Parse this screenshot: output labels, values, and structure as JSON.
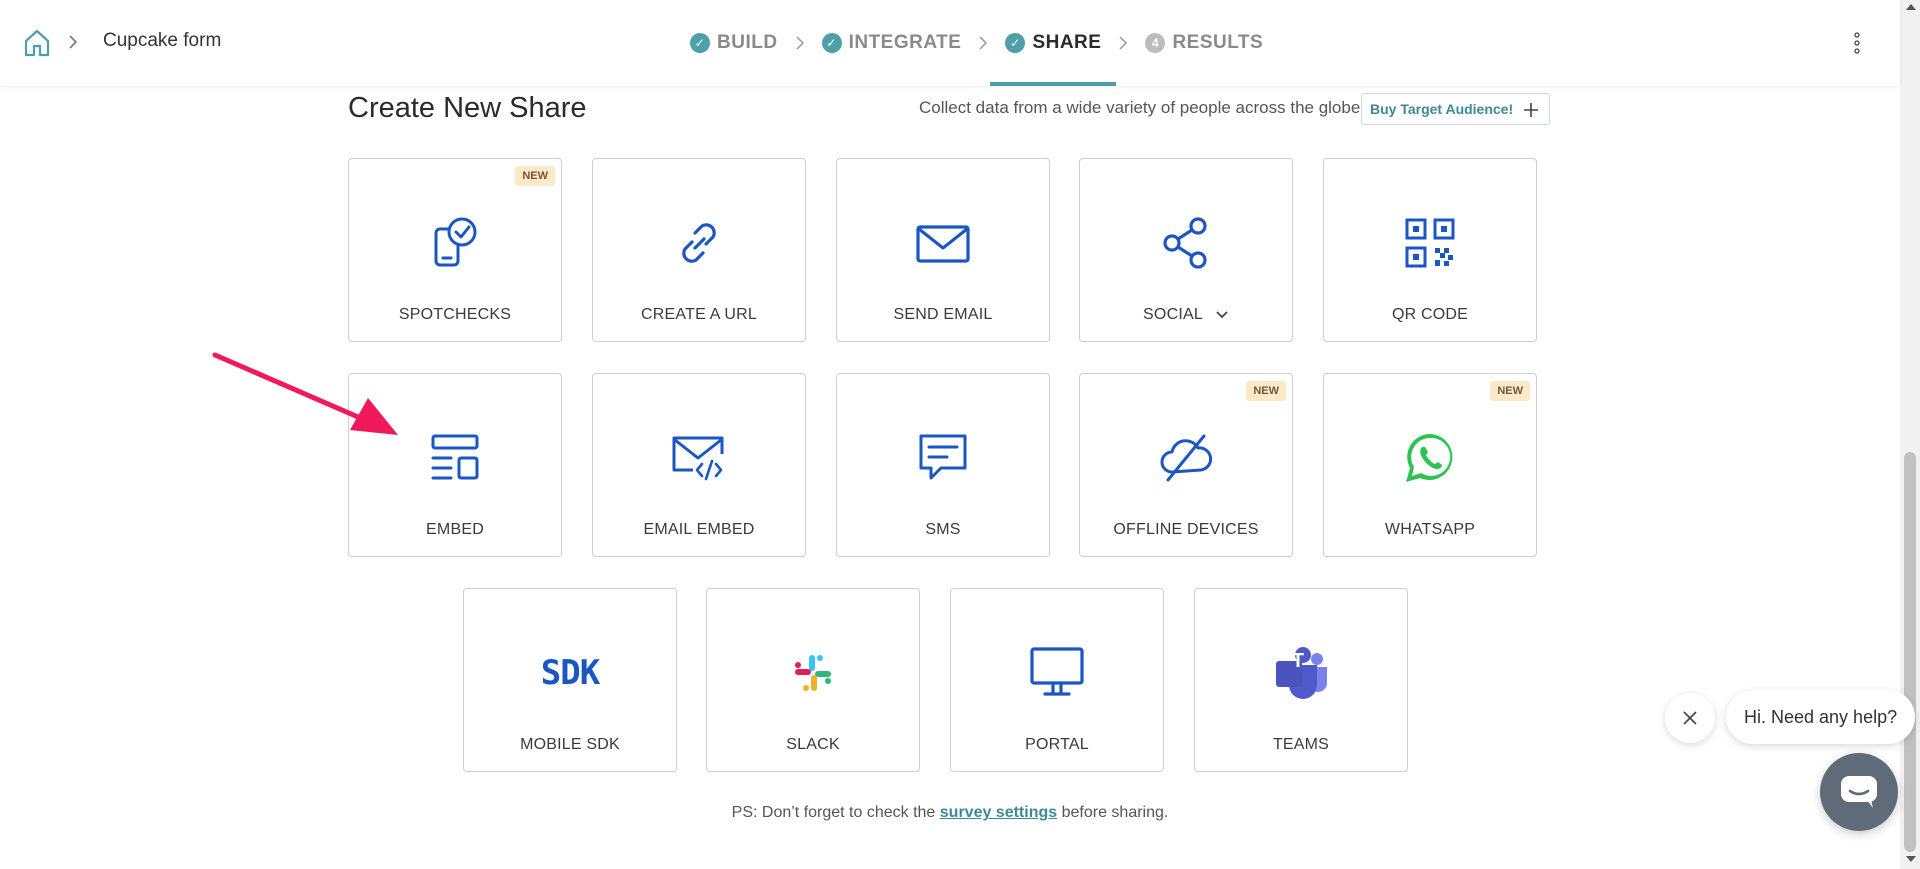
{
  "header": {
    "breadcrumb_title": "Cupcake form",
    "steps": [
      {
        "label": "BUILD",
        "state": "done"
      },
      {
        "label": "INTEGRATE",
        "state": "done"
      },
      {
        "label": "SHARE",
        "state": "active"
      },
      {
        "label": "RESULTS",
        "state": "pending",
        "number": "4"
      }
    ]
  },
  "section": {
    "title": "Create New Share",
    "collect_text": "Collect data from a wide variety of people across the globe",
    "buy_button": "Buy Target Audience!"
  },
  "cards": {
    "spotchecks": {
      "label": "SPOTCHECKS",
      "badge": "NEW"
    },
    "create_url": {
      "label": "CREATE A URL"
    },
    "send_email": {
      "label": "SEND EMAIL"
    },
    "social": {
      "label": "SOCIAL"
    },
    "qr_code": {
      "label": "QR CODE"
    },
    "embed": {
      "label": "EMBED"
    },
    "email_embed": {
      "label": "EMAIL EMBED"
    },
    "sms": {
      "label": "SMS"
    },
    "offline_devices": {
      "label": "OFFLINE DEVICES",
      "badge": "NEW"
    },
    "whatsapp": {
      "label": "WHATSAPP",
      "badge": "NEW"
    },
    "mobile_sdk": {
      "label": "MOBILE SDK",
      "icon_text": "SDK"
    },
    "slack": {
      "label": "SLACK"
    },
    "portal": {
      "label": "PORTAL"
    },
    "teams": {
      "label": "TEAMS",
      "icon_text": "T"
    }
  },
  "footer": {
    "prefix": "PS: Don’t forget to check the ",
    "link": "survey settings",
    "suffix": " before sharing."
  },
  "chat": {
    "bubble_text": "Hi. Need any help?"
  },
  "colors": {
    "accent": "#4f9fab",
    "icon_blue": "#1a56c4",
    "badge_bg": "#fde8c7",
    "annotation_arrow": "#f0195b",
    "whatsapp_green": "#2cc353",
    "teams_purple": "#5059c9"
  }
}
